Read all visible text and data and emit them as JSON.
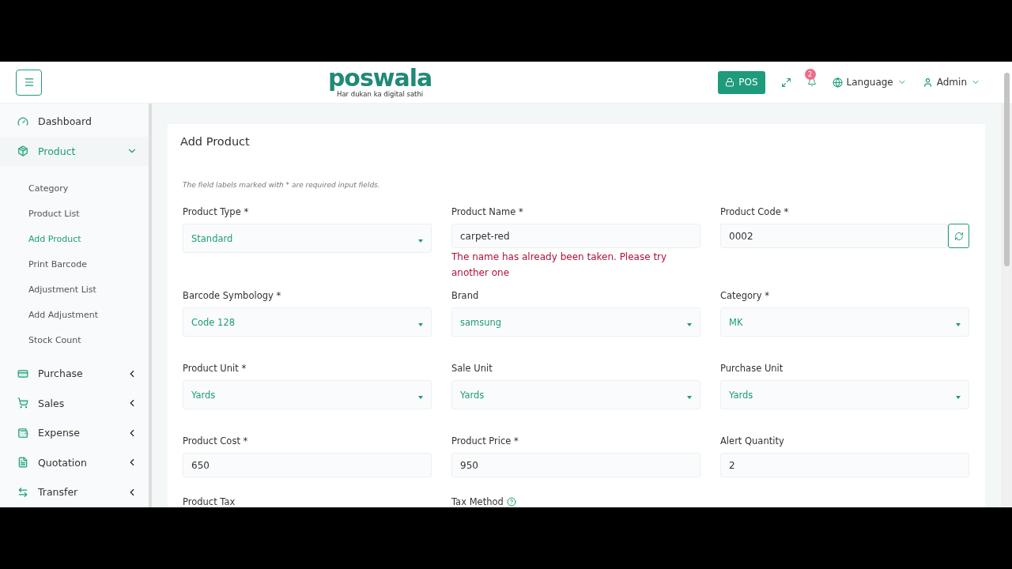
{
  "header": {
    "logo": "poswala",
    "tagline": "Har dukan ka digital sathi",
    "pos_button": "POS",
    "notification_count": "2",
    "language": "Language",
    "user": "Admin"
  },
  "sidebar": {
    "items": [
      {
        "label": "Dashboard",
        "expanded": false
      },
      {
        "label": "Product",
        "expanded": true,
        "children": [
          {
            "label": "Category",
            "selected": false
          },
          {
            "label": "Product List",
            "selected": false
          },
          {
            "label": "Add Product",
            "selected": true
          },
          {
            "label": "Print Barcode",
            "selected": false
          },
          {
            "label": "Adjustment List",
            "selected": false
          },
          {
            "label": "Add Adjustment",
            "selected": false
          },
          {
            "label": "Stock Count",
            "selected": false
          }
        ]
      },
      {
        "label": "Purchase",
        "expanded": false
      },
      {
        "label": "Sales",
        "expanded": false
      },
      {
        "label": "Expense",
        "expanded": false
      },
      {
        "label": "Quotation",
        "expanded": false
      },
      {
        "label": "Transfer",
        "expanded": false
      }
    ]
  },
  "form": {
    "title": "Add Product",
    "note": "The field labels marked with * are required input fields.",
    "fields": [
      {
        "label": "Product Type *",
        "kind": "select",
        "value": "Standard"
      },
      {
        "label": "Product Name *",
        "kind": "input",
        "value": "carpet-red",
        "error": "The name has already been taken. Please try another one"
      },
      {
        "label": "Product Code *",
        "kind": "input_button",
        "value": "0002"
      },
      {
        "label": "Barcode Symbology *",
        "kind": "select",
        "value": "Code 128"
      },
      {
        "label": "Brand",
        "kind": "select",
        "value": "samsung"
      },
      {
        "label": "Category *",
        "kind": "select",
        "value": "MK"
      },
      {
        "label": "Product Unit *",
        "kind": "select",
        "value": "Yards"
      },
      {
        "label": "Sale Unit",
        "kind": "select",
        "value": "Yards"
      },
      {
        "label": "Purchase Unit",
        "kind": "select",
        "value": "Yards"
      },
      {
        "label": "Product Cost *",
        "kind": "input",
        "value": "650"
      },
      {
        "label": "Product Price *",
        "kind": "input",
        "value": "950"
      },
      {
        "label": "Alert Quantity",
        "kind": "input",
        "value": "2"
      },
      {
        "label": "Product Tax",
        "kind": "label_only"
      },
      {
        "label": "Tax Method",
        "kind": "label_help"
      }
    ]
  }
}
